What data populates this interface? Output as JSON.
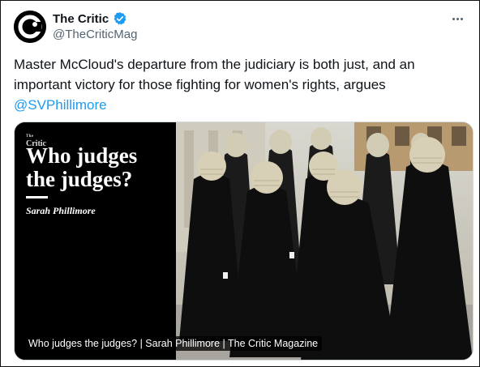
{
  "account": {
    "display_name": "The Critic",
    "handle": "@TheCriticMag",
    "avatar_letter": "c",
    "verified_color": "#1d9bf0"
  },
  "tweet": {
    "text": "Master McCloud's departure from the judiciary is both just, and an important victory for those fighting for women's rights, argues ",
    "mention": "@SVPhillimore",
    "mention_color": "#1d9bf0"
  },
  "card": {
    "brand_small_the": "The",
    "brand_small_name": "Critic",
    "title_line1": "Who judges",
    "title_line2": "the judges?",
    "author": "Sarah Phillimore",
    "caption": "Who judges the judges? | Sarah Phillimore | The Critic Magazine",
    "photo_subject": "barristers-in-wigs-and-black-gowns"
  },
  "icons": {
    "more": "more-horizontal-icon",
    "verified": "verified-badge-icon"
  }
}
